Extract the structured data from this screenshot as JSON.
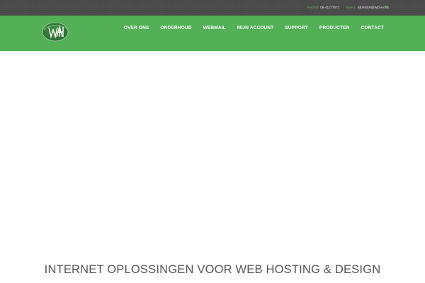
{
  "topbar": {
    "phone_label": "PHONE",
    "phone_value": "06-41177071",
    "email_label": "EMAIL",
    "email_value": "BEHEER@WDAH.NL",
    "social_icon": "linkedin-icon",
    "social_text": "in"
  },
  "logo": {
    "icon": "wdah-logo"
  },
  "nav": {
    "items": [
      {
        "label": "OVER ONS"
      },
      {
        "label": "ONDERHOUD"
      },
      {
        "label": "WEBMAIL"
      },
      {
        "label": "MIJN ACCOUNT"
      },
      {
        "label": "SUPPORT"
      },
      {
        "label": "PRODUCTEN"
      },
      {
        "label": "CONTACT"
      }
    ]
  },
  "hero": {
    "headline": "INTERNET OPLOSSINGEN VOOR WEB HOSTING & DESIGN"
  },
  "colors": {
    "accent_green": "#53b057",
    "topbar_dark": "#4a4a4a",
    "headline_gray": "#555555"
  }
}
